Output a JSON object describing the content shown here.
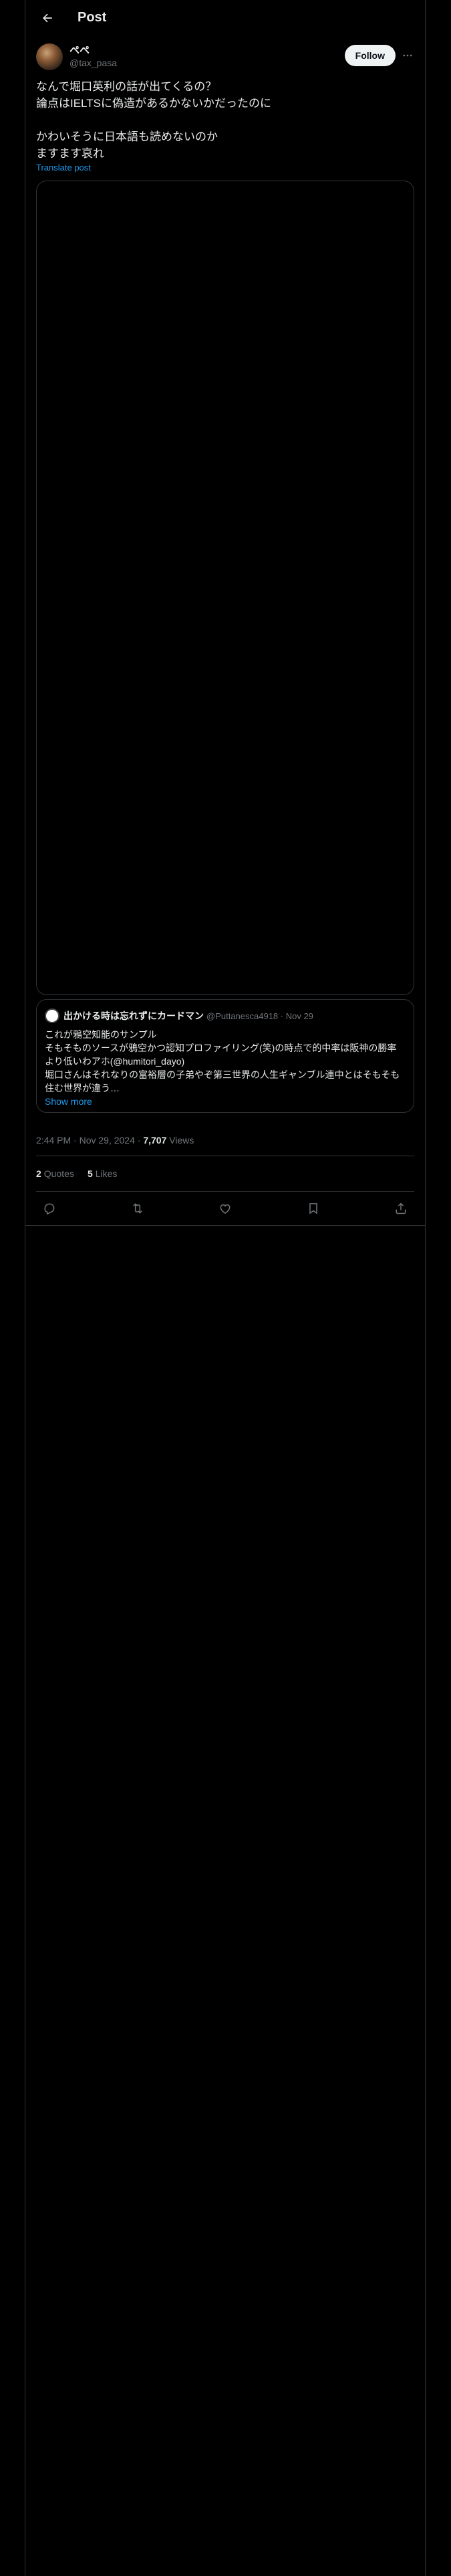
{
  "header": {
    "title": "Post"
  },
  "author": {
    "display_name": "ペペ",
    "handle": "@tax_pasa"
  },
  "follow_label": "Follow",
  "post": {
    "text": "なんで堀口英利の話が出てくるの？\n論点はIELTSに偽造があるかないかだったのに\n\nかわいそうに日本語も読めないのか\nますます哀れ",
    "translate_label": "Translate post"
  },
  "quote": {
    "display_name": "出かける時は忘れずにカードマン",
    "handle_date": "@Puttanesca4918 · Nov 29",
    "text": "これが鴉空知能のサンプル\nそもそものソースが鴉空かつ認知プロファイリング(笑)の時点で的中率は阪神の勝率より低いわアホ(@humitori_dayo)\n堀口さんはそれなりの富裕層の子弟やぞ第三世界の人生ギャンブル連中とはそもそも住む世界が違う…",
    "show_more": "Show more"
  },
  "meta": {
    "time_date": "2:44 PM · Nov 29, 2024 · ",
    "views_count": "7,707",
    "views_label": " Views"
  },
  "stats": {
    "quotes_count": "2",
    "quotes_label": "Quotes",
    "likes_count": "5",
    "likes_label": "Likes"
  },
  "icons": [
    "back-arrow-icon",
    "more-icon",
    "reply-icon",
    "repost-icon",
    "like-icon",
    "bookmark-icon",
    "share-icon"
  ],
  "colors": {
    "background": "#000000",
    "text": "#e7e9ea",
    "muted": "#71767b",
    "link": "#1d9bf0",
    "border": "#2f3336"
  }
}
